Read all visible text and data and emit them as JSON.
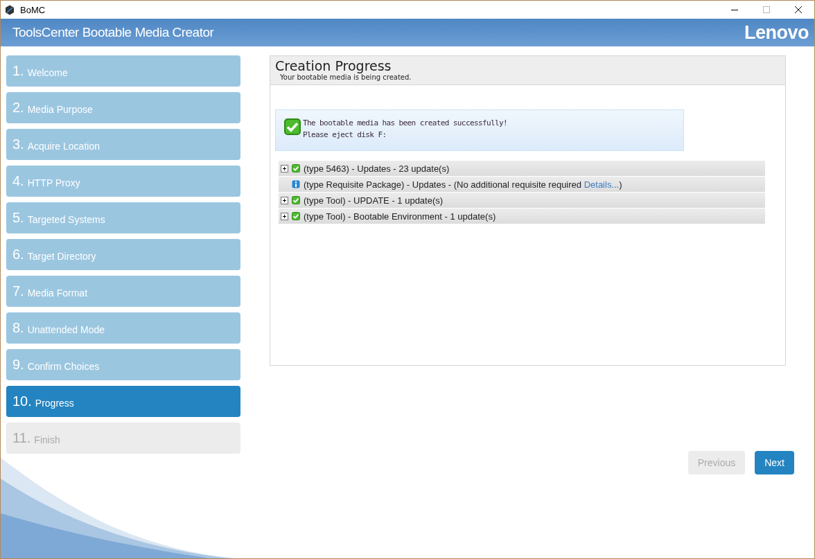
{
  "window": {
    "title": "BoMC"
  },
  "header": {
    "title": "ToolsCenter Bootable Media Creator",
    "logo": "Lenovo"
  },
  "steps": [
    {
      "number": "1.",
      "label": "Welcome",
      "selected": false,
      "disabled": false
    },
    {
      "number": "2.",
      "label": "Media Purpose",
      "selected": false,
      "disabled": false
    },
    {
      "number": "3.",
      "label": "Acquire Location",
      "selected": false,
      "disabled": false
    },
    {
      "number": "4.",
      "label": "HTTP Proxy",
      "selected": false,
      "disabled": false
    },
    {
      "number": "5.",
      "label": "Targeted Systems",
      "selected": false,
      "disabled": false
    },
    {
      "number": "6.",
      "label": "Target Directory",
      "selected": false,
      "disabled": false
    },
    {
      "number": "7.",
      "label": "Media Format",
      "selected": false,
      "disabled": false
    },
    {
      "number": "8.",
      "label": "Unattended Mode",
      "selected": false,
      "disabled": false
    },
    {
      "number": "9.",
      "label": "Confirm Choices",
      "selected": false,
      "disabled": false
    },
    {
      "number": "10.",
      "label": "Progress",
      "selected": true,
      "disabled": false
    },
    {
      "number": "11.",
      "label": "Finish",
      "selected": false,
      "disabled": true
    }
  ],
  "panel": {
    "title": "Creation Progress",
    "subtitle": "Your bootable media is being created.",
    "message": {
      "lines": [
        "The bootable media has been created successfully!",
        "Please eject disk F:"
      ]
    },
    "rows": [
      {
        "kind": "expandable",
        "text": "(type 5463) - Updates - 23 update(s)"
      },
      {
        "kind": "info",
        "text": "(type Requisite Package) - Updates - (No additional requisite required ",
        "link": "Details...",
        "text_after": ")"
      },
      {
        "kind": "expandable",
        "text": "(type Tool) - UPDATE - 1 update(s)"
      },
      {
        "kind": "expandable",
        "text": "(type Tool) - Bootable Environment - 1 update(s)"
      }
    ]
  },
  "buttons": [
    {
      "label": "Previous",
      "disabled": true
    },
    {
      "label": "Next",
      "disabled": false
    }
  ]
}
